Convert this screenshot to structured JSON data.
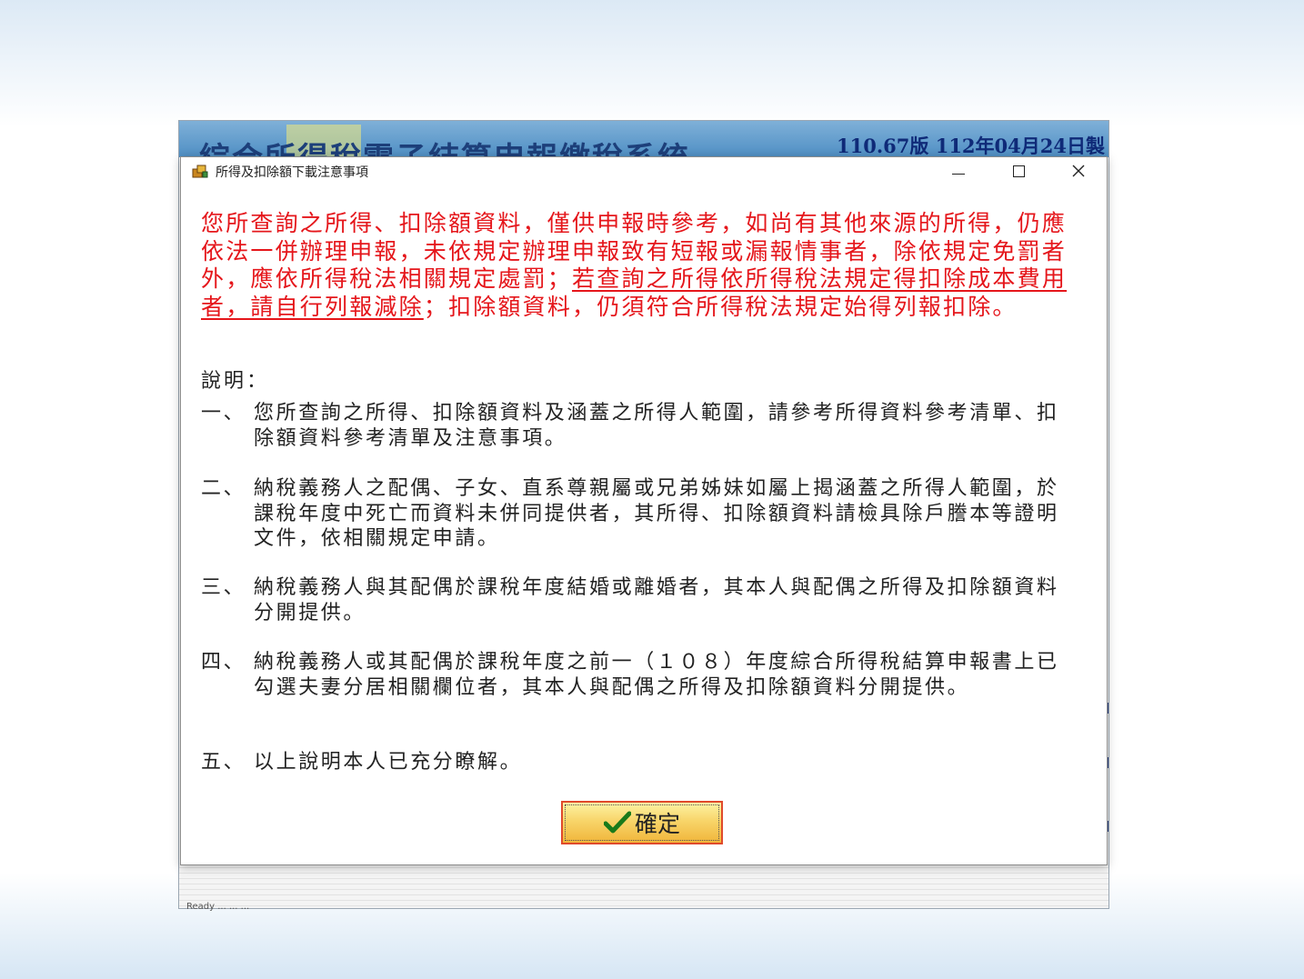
{
  "background_app": {
    "title": "綜合所得稅電子結算申報繳稅系統",
    "version": "110.67版  112年04月24日製",
    "footer_text": "Ready ... ... ..."
  },
  "dialog": {
    "title": "所得及扣除額下載注意事項",
    "controls": {
      "minimize": "—",
      "maximize": "☐",
      "close": "✕"
    },
    "notice": {
      "part1": "您所查詢之所得、扣除額資料，僅供申報時參考，如尚有其他來源的所得，仍應依法一併辦理申報，未依規定辦理申報致有短報或漏報情事者，除依規定免罰者外，應依所得稅法相關規定處罰；",
      "underlined": "若查詢之所得依所得稅法規定得扣除成本費用者，請自行列報減除",
      "part2": "；扣除額資料，仍須符合所得稅法規定始得列報扣除。",
      "color": "#e5161b"
    },
    "description_heading": "說明：",
    "items": [
      {
        "num": "一、",
        "text": "您所查詢之所得、扣除額資料及涵蓋之所得人範圍，請參考所得資料參考清單、扣除額資料參考清單及注意事項。"
      },
      {
        "num": "二、",
        "text": "納稅義務人之配偶、子女、直系尊親屬或兄弟姊妹如屬上揭涵蓋之所得人範圍，於課稅年度中死亡而資料未併同提供者，其所得、扣除額資料請檢具除戶謄本等證明文件，依相關規定申請。"
      },
      {
        "num": "三、",
        "text": "納稅義務人與其配偶於課稅年度結婚或離婚者，其本人與配偶之所得及扣除額資料分開提供。"
      },
      {
        "num": "四、",
        "text": "納稅義務人或其配偶於課稅年度之前一（１０８）年度綜合所得稅結算申報書上已勾選夫妻分居相關欄位者，其本人與配偶之所得及扣除額資料分開提供。"
      },
      {
        "num": "五、",
        "text": "以上說明本人已充分瞭解。"
      }
    ],
    "ok_button": {
      "label": "確定",
      "icon": "checkmark-icon"
    }
  },
  "colors": {
    "notice_red": "#e5161b",
    "button_border": "#e04a2b",
    "button_fill": "#f8d56a",
    "checkmark": "#1a7a1a",
    "banner_blue": "#4f8fc4"
  }
}
